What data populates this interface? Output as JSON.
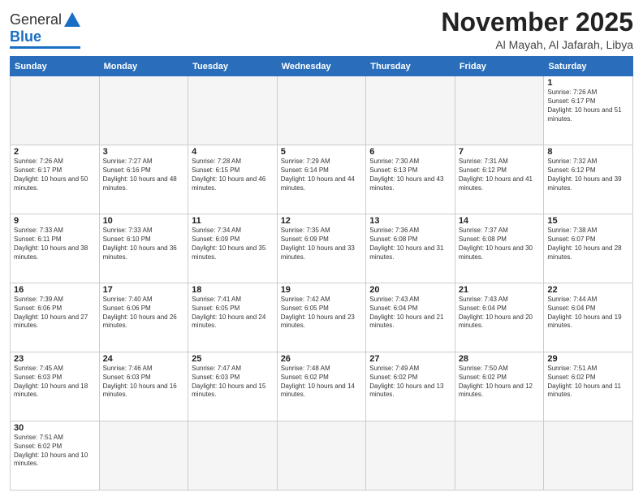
{
  "logo": {
    "general": "General",
    "blue": "Blue"
  },
  "title": {
    "month": "November 2025",
    "location": "Al Mayah, Al Jafarah, Libya"
  },
  "weekdays": [
    "Sunday",
    "Monday",
    "Tuesday",
    "Wednesday",
    "Thursday",
    "Friday",
    "Saturday"
  ],
  "days": [
    {
      "date": 1,
      "sunrise": "7:26 AM",
      "sunset": "6:17 PM",
      "daylight": "10 hours and 51 minutes."
    },
    {
      "date": 2,
      "sunrise": "7:26 AM",
      "sunset": "6:17 PM",
      "daylight": "10 hours and 50 minutes."
    },
    {
      "date": 3,
      "sunrise": "7:27 AM",
      "sunset": "6:16 PM",
      "daylight": "10 hours and 48 minutes."
    },
    {
      "date": 4,
      "sunrise": "7:28 AM",
      "sunset": "6:15 PM",
      "daylight": "10 hours and 46 minutes."
    },
    {
      "date": 5,
      "sunrise": "7:29 AM",
      "sunset": "6:14 PM",
      "daylight": "10 hours and 44 minutes."
    },
    {
      "date": 6,
      "sunrise": "7:30 AM",
      "sunset": "6:13 PM",
      "daylight": "10 hours and 43 minutes."
    },
    {
      "date": 7,
      "sunrise": "7:31 AM",
      "sunset": "6:12 PM",
      "daylight": "10 hours and 41 minutes."
    },
    {
      "date": 8,
      "sunrise": "7:32 AM",
      "sunset": "6:12 PM",
      "daylight": "10 hours and 39 minutes."
    },
    {
      "date": 9,
      "sunrise": "7:33 AM",
      "sunset": "6:11 PM",
      "daylight": "10 hours and 38 minutes."
    },
    {
      "date": 10,
      "sunrise": "7:33 AM",
      "sunset": "6:10 PM",
      "daylight": "10 hours and 36 minutes."
    },
    {
      "date": 11,
      "sunrise": "7:34 AM",
      "sunset": "6:09 PM",
      "daylight": "10 hours and 35 minutes."
    },
    {
      "date": 12,
      "sunrise": "7:35 AM",
      "sunset": "6:09 PM",
      "daylight": "10 hours and 33 minutes."
    },
    {
      "date": 13,
      "sunrise": "7:36 AM",
      "sunset": "6:08 PM",
      "daylight": "10 hours and 31 minutes."
    },
    {
      "date": 14,
      "sunrise": "7:37 AM",
      "sunset": "6:08 PM",
      "daylight": "10 hours and 30 minutes."
    },
    {
      "date": 15,
      "sunrise": "7:38 AM",
      "sunset": "6:07 PM",
      "daylight": "10 hours and 28 minutes."
    },
    {
      "date": 16,
      "sunrise": "7:39 AM",
      "sunset": "6:06 PM",
      "daylight": "10 hours and 27 minutes."
    },
    {
      "date": 17,
      "sunrise": "7:40 AM",
      "sunset": "6:06 PM",
      "daylight": "10 hours and 26 minutes."
    },
    {
      "date": 18,
      "sunrise": "7:41 AM",
      "sunset": "6:05 PM",
      "daylight": "10 hours and 24 minutes."
    },
    {
      "date": 19,
      "sunrise": "7:42 AM",
      "sunset": "6:05 PM",
      "daylight": "10 hours and 23 minutes."
    },
    {
      "date": 20,
      "sunrise": "7:43 AM",
      "sunset": "6:04 PM",
      "daylight": "10 hours and 21 minutes."
    },
    {
      "date": 21,
      "sunrise": "7:43 AM",
      "sunset": "6:04 PM",
      "daylight": "10 hours and 20 minutes."
    },
    {
      "date": 22,
      "sunrise": "7:44 AM",
      "sunset": "6:04 PM",
      "daylight": "10 hours and 19 minutes."
    },
    {
      "date": 23,
      "sunrise": "7:45 AM",
      "sunset": "6:03 PM",
      "daylight": "10 hours and 18 minutes."
    },
    {
      "date": 24,
      "sunrise": "7:46 AM",
      "sunset": "6:03 PM",
      "daylight": "10 hours and 16 minutes."
    },
    {
      "date": 25,
      "sunrise": "7:47 AM",
      "sunset": "6:03 PM",
      "daylight": "10 hours and 15 minutes."
    },
    {
      "date": 26,
      "sunrise": "7:48 AM",
      "sunset": "6:02 PM",
      "daylight": "10 hours and 14 minutes."
    },
    {
      "date": 27,
      "sunrise": "7:49 AM",
      "sunset": "6:02 PM",
      "daylight": "10 hours and 13 minutes."
    },
    {
      "date": 28,
      "sunrise": "7:50 AM",
      "sunset": "6:02 PM",
      "daylight": "10 hours and 12 minutes."
    },
    {
      "date": 29,
      "sunrise": "7:51 AM",
      "sunset": "6:02 PM",
      "daylight": "10 hours and 11 minutes."
    },
    {
      "date": 30,
      "sunrise": "7:51 AM",
      "sunset": "6:02 PM",
      "daylight": "10 hours and 10 minutes."
    }
  ]
}
